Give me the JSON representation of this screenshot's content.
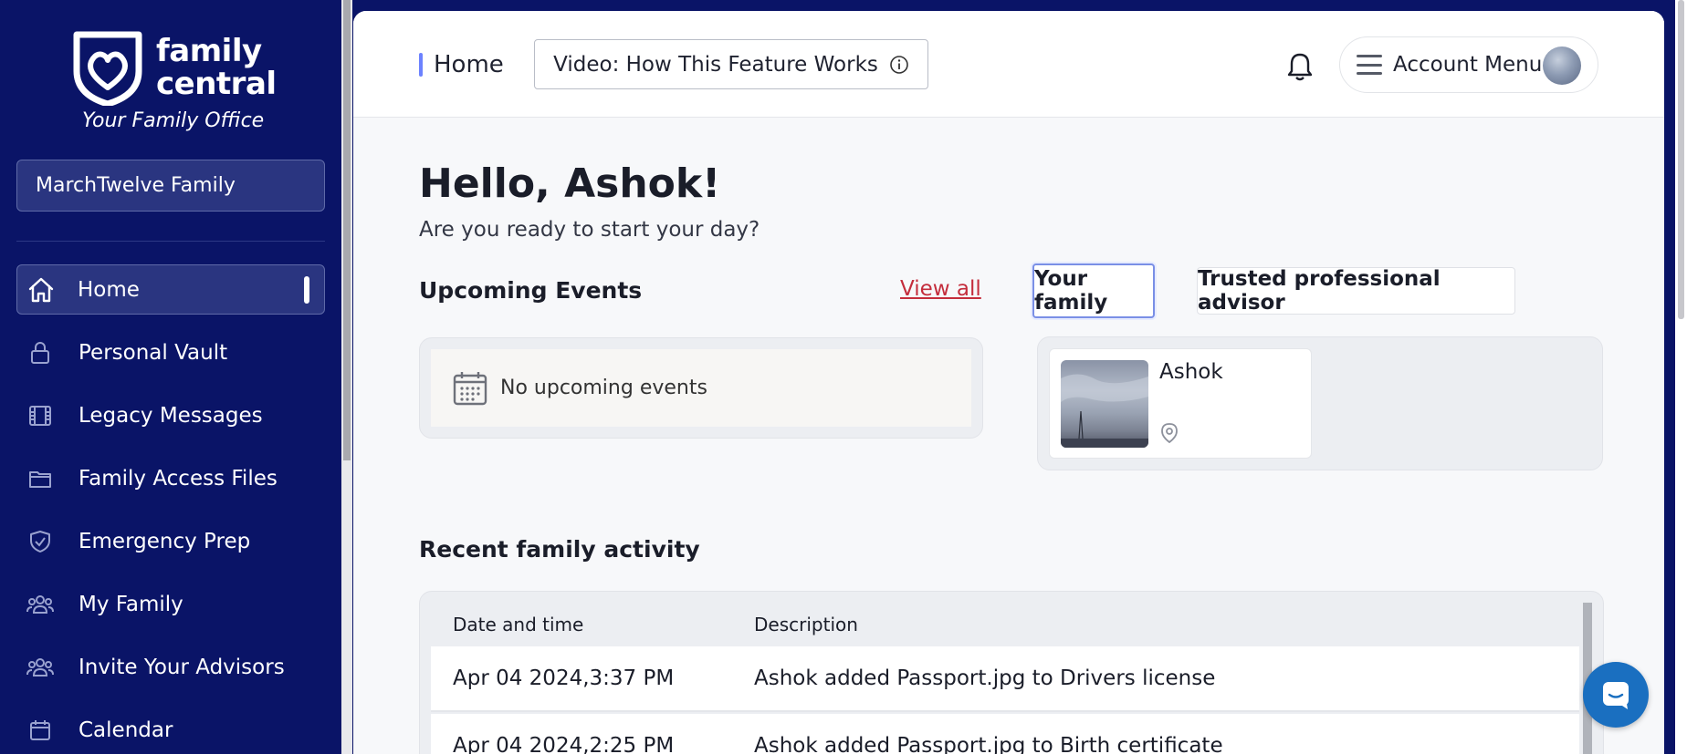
{
  "brand": {
    "name": "family\ncentral",
    "tagline": "Your Family Office"
  },
  "family_selector": {
    "value": "MarchTwelve Family"
  },
  "sidebar": {
    "items": [
      {
        "label": "Home",
        "icon": "home-icon",
        "active": true
      },
      {
        "label": "Personal Vault",
        "icon": "lock-icon"
      },
      {
        "label": "Legacy Messages",
        "icon": "film-icon"
      },
      {
        "label": "Family Access Files",
        "icon": "folder-icon"
      },
      {
        "label": "Emergency Prep",
        "icon": "shield-check-icon"
      },
      {
        "label": "My Family",
        "icon": "people-icon"
      },
      {
        "label": "Invite Your Advisors",
        "icon": "people-icon"
      },
      {
        "label": "Calendar",
        "icon": "calendar-icon"
      }
    ]
  },
  "header": {
    "breadcrumb": "Home",
    "video_button": "Video: How This Feature Works",
    "account_menu": "Account Menu"
  },
  "main": {
    "greeting": "Hello, Ashok!",
    "subgreeting": "Are you ready to start your day?",
    "upcoming_events": {
      "title": "Upcoming Events",
      "view_all": "View all",
      "empty_text": "No upcoming events"
    },
    "family_tabs": [
      {
        "label": "Your family",
        "active": true
      },
      {
        "label": "Trusted professional advisor",
        "active": false
      }
    ],
    "members": [
      {
        "name": "Ashok"
      }
    ],
    "activity": {
      "title": "Recent family activity",
      "columns": [
        "Date and time",
        "Description"
      ],
      "rows": [
        {
          "date": "Apr 04 2024,3:37 PM",
          "description": "Ashok added Passport.jpg to Drivers license"
        },
        {
          "date": "Apr 04 2024,2:25 PM",
          "description": "Ashok added Passport.jpg to Birth certificate"
        }
      ]
    }
  },
  "colors": {
    "sidebar_bg": "#0a1467",
    "accent": "#6c82ff",
    "link_red": "#c42d3c",
    "chat_button": "#1a6fc0"
  }
}
